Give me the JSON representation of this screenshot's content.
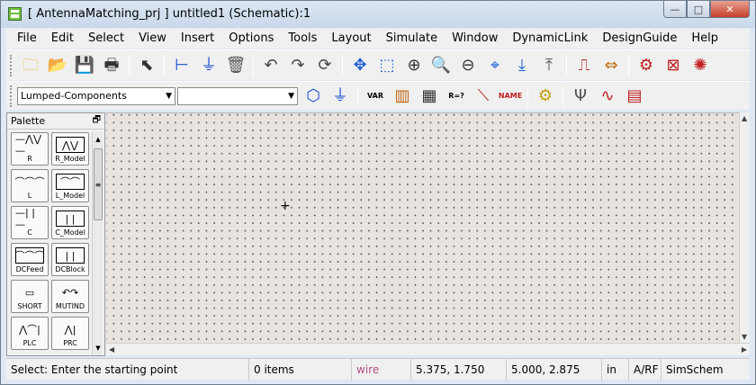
{
  "window": {
    "title": "[ AntennaMatching_prj ] untitled1 (Schematic):1",
    "min_glyph": "—",
    "max_glyph": "□",
    "close_glyph": "✕"
  },
  "menu": [
    "File",
    "Edit",
    "Select",
    "View",
    "Insert",
    "Options",
    "Tools",
    "Layout",
    "Simulate",
    "Window",
    "DynamicLink",
    "DesignGuide",
    "Help"
  ],
  "toolbar1": [
    {
      "name": "new-icon",
      "glyph": "🗀",
      "color": "#e8c04a"
    },
    {
      "name": "open-icon",
      "glyph": "📂",
      "color": "#e8b030"
    },
    {
      "name": "save-icon",
      "glyph": "💾",
      "color": "#222"
    },
    {
      "name": "print-icon",
      "glyph": "🖶",
      "color": "#333"
    },
    {
      "name": "select-pointer-icon",
      "glyph": "⬉",
      "color": "#333"
    },
    {
      "name": "insert-pin-icon",
      "glyph": "⊢",
      "color": "#1a4fd1"
    },
    {
      "name": "insert-ground-icon",
      "glyph": "⏚",
      "color": "#1a4fd1"
    },
    {
      "name": "delete-icon",
      "glyph": "🗑",
      "color": "#555"
    },
    {
      "name": "undo-icon",
      "glyph": "↶",
      "color": "#444"
    },
    {
      "name": "redo-icon",
      "glyph": "↷",
      "color": "#444"
    },
    {
      "name": "rotate-icon",
      "glyph": "⟳",
      "color": "#444"
    },
    {
      "name": "move-icon",
      "glyph": "✥",
      "color": "#1a5fd1"
    },
    {
      "name": "zoom-area-icon",
      "glyph": "⬚",
      "color": "#1a5fd1"
    },
    {
      "name": "zoom-in-icon",
      "glyph": "⊕",
      "color": "#333"
    },
    {
      "name": "zoom-in-2x-icon",
      "glyph": "🔍",
      "color": "#333"
    },
    {
      "name": "zoom-out-icon",
      "glyph": "⊖",
      "color": "#333"
    },
    {
      "name": "zoom-fit-icon",
      "glyph": "⌖",
      "color": "#1a5fd1"
    },
    {
      "name": "push-into-icon",
      "glyph": "⤓",
      "color": "#1a5fd1"
    },
    {
      "name": "pop-out-icon",
      "glyph": "⤒",
      "color": "#555"
    },
    {
      "name": "wire-icon",
      "glyph": "⎍",
      "color": "#c02020"
    },
    {
      "name": "component-icon",
      "glyph": "⇔",
      "color": "#c07010"
    },
    {
      "name": "simulate-icon",
      "glyph": "⚙",
      "color": "#c02020"
    },
    {
      "name": "tune-icon",
      "glyph": "⊠",
      "color": "#c02020"
    },
    {
      "name": "optimize-icon",
      "glyph": "✺",
      "color": "#c02020"
    }
  ],
  "library_combo": "Lumped-Components",
  "search_combo": "",
  "toolbar2": [
    {
      "name": "port-icon",
      "glyph": "⬡",
      "color": "#1a4fd1"
    },
    {
      "name": "ground-icon",
      "glyph": "⏚",
      "color": "#1a4fd1"
    },
    {
      "name": "var-icon",
      "glyph": "VAR",
      "color": "#000"
    },
    {
      "name": "sim-controller-icon",
      "glyph": "▥",
      "color": "#c06010"
    },
    {
      "name": "display-icon",
      "glyph": "▦",
      "color": "#333"
    },
    {
      "name": "equation-icon",
      "glyph": "R=?",
      "color": "#000"
    },
    {
      "name": "wire-draw-icon",
      "glyph": "⟍",
      "color": "#c02020"
    },
    {
      "name": "name-icon",
      "glyph": "NAME",
      "color": "#c02020"
    },
    {
      "name": "settings-icon",
      "glyph": "⚙",
      "color": "#c0a010"
    },
    {
      "name": "probe-icon",
      "glyph": "Ψ",
      "color": "#555"
    },
    {
      "name": "plot-icon",
      "glyph": "∿",
      "color": "#c02020"
    },
    {
      "name": "export-icon",
      "glyph": "▤",
      "color": "#c02020"
    }
  ],
  "palette": {
    "title": "Palette",
    "dock_glyph": "🗗",
    "items": [
      {
        "label": "R",
        "symbol": "—⋀⋁—",
        "boxed": false
      },
      {
        "label": "R_Model",
        "symbol": "⋀⋁",
        "boxed": true
      },
      {
        "label": "L",
        "symbol": "⌒⌒⌒",
        "boxed": false
      },
      {
        "label": "L_Model",
        "symbol": "⌒⌒",
        "boxed": true
      },
      {
        "label": "C",
        "symbol": "—| |—",
        "boxed": false
      },
      {
        "label": "C_Model",
        "symbol": "| |",
        "boxed": true
      },
      {
        "label": "DCFeed",
        "symbol": "⌒⌒⌒",
        "boxed": true
      },
      {
        "label": "DCBlock",
        "symbol": "| |",
        "boxed": true
      },
      {
        "label": "SHORT",
        "symbol": "▭",
        "boxed": false
      },
      {
        "label": "MUTIND",
        "symbol": "↶↷",
        "boxed": false
      },
      {
        "label": "PLC",
        "symbol": "⋀⌒|",
        "boxed": false
      },
      {
        "label": "PRC",
        "symbol": "⋀|",
        "boxed": false
      }
    ]
  },
  "canvas": {
    "cursor_glyph": "+"
  },
  "status": {
    "message": "Select: Enter the starting point",
    "items": "0 items",
    "mode": "wire",
    "coord1": "5.375, 1.750",
    "coord2": "5.000, 2.875",
    "units": "in",
    "tech": "A/RF",
    "sim": "SimSchem"
  },
  "colors": {
    "mode_text": "#b05080",
    "canvas_bg": "#e8e3df"
  }
}
